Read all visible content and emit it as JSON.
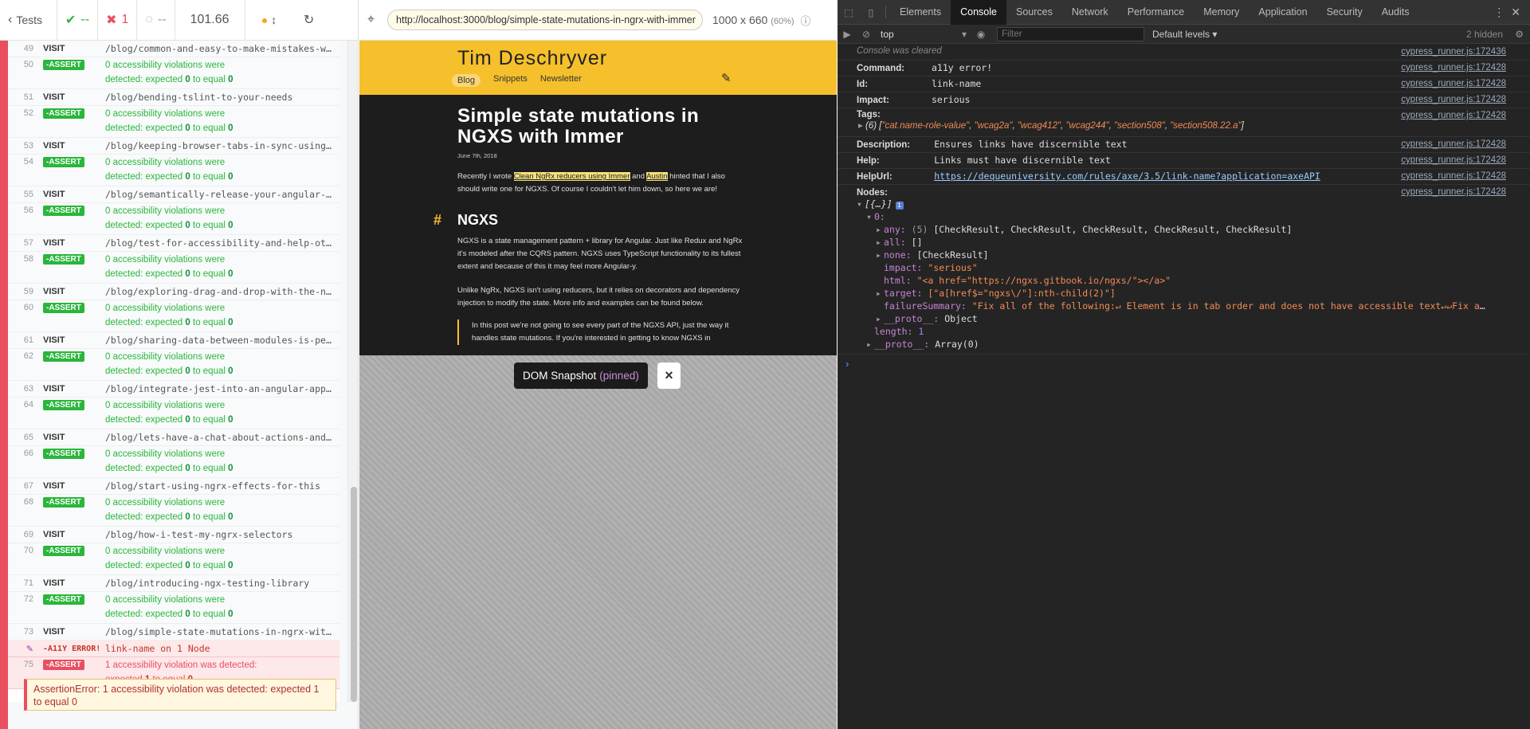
{
  "reporter": {
    "back_label": "Tests",
    "passed": "--",
    "failed": "1",
    "pending": "--",
    "duration": "101.66",
    "commands": [
      {
        "num": "49",
        "name": "VISIT",
        "msg": "/blog/common-and-easy-to-make-mistakes-when-you-re-new-to-ngrx"
      },
      {
        "num": "50",
        "name": "-ASSERT",
        "assert": true,
        "msg_a": "0 accessibility violations were",
        "msg_b": "detected: expected",
        "v1": "0",
        "to": "to equal",
        "v2": "0"
      },
      {
        "num": "51",
        "name": "VISIT",
        "msg": "/blog/bending-tslint-to-your-needs"
      },
      {
        "num": "52",
        "name": "-ASSERT",
        "assert": true,
        "msg_a": "0 accessibility violations were",
        "msg_b": "detected: expected",
        "v1": "0",
        "to": "to equal",
        "v2": "0"
      },
      {
        "num": "53",
        "name": "VISIT",
        "msg": "/blog/keeping-browser-tabs-in-sync-using-localstorage-ngrx-and-rxjs"
      },
      {
        "num": "54",
        "name": "-ASSERT",
        "assert": true,
        "msg_a": "0 accessibility violations were",
        "msg_b": "detected: expected",
        "v1": "0",
        "to": "to equal",
        "v2": "0"
      },
      {
        "num": "55",
        "name": "VISIT",
        "msg": "/blog/semantically-release-your-angular-library"
      },
      {
        "num": "56",
        "name": "-ASSERT",
        "assert": true,
        "msg_a": "0 accessibility violations were",
        "msg_b": "detected: expected",
        "v1": "0",
        "to": "to equal",
        "v2": "0"
      },
      {
        "num": "57",
        "name": "VISIT",
        "msg": "/blog/test-for-accessibility-and-help-others-to-do-the-same"
      },
      {
        "num": "58",
        "name": "-ASSERT",
        "assert": true,
        "msg_a": "0 accessibility violations were",
        "msg_b": "detected: expected",
        "v1": "0",
        "to": "to equal",
        "v2": "0"
      },
      {
        "num": "59",
        "name": "VISIT",
        "msg": "/blog/exploring-drag-and-drop-with-the-new-angular-material-cdk"
      },
      {
        "num": "60",
        "name": "-ASSERT",
        "assert": true,
        "msg_a": "0 accessibility violations were",
        "msg_b": "detected: expected",
        "v1": "0",
        "to": "to equal",
        "v2": "0"
      },
      {
        "num": "61",
        "name": "VISIT",
        "msg": "/blog/sharing-data-between-modules-is-peanuts"
      },
      {
        "num": "62",
        "name": "-ASSERT",
        "assert": true,
        "msg_a": "0 accessibility violations were",
        "msg_b": "detected: expected",
        "v1": "0",
        "to": "to equal",
        "v2": "0"
      },
      {
        "num": "63",
        "name": "VISIT",
        "msg": "/blog/integrate-jest-into-an-angular-application-and-library"
      },
      {
        "num": "64",
        "name": "-ASSERT",
        "assert": true,
        "msg_a": "0 accessibility violations were",
        "msg_b": "detected: expected",
        "v1": "0",
        "to": "to equal",
        "v2": "0"
      },
      {
        "num": "65",
        "name": "VISIT",
        "msg": "/blog/lets-have-a-chat-about-actions-and-selectors"
      },
      {
        "num": "66",
        "name": "-ASSERT",
        "assert": true,
        "msg_a": "0 accessibility violations were",
        "msg_b": "detected: expected",
        "v1": "0",
        "to": "to equal",
        "v2": "0"
      },
      {
        "num": "67",
        "name": "VISIT",
        "msg": "/blog/start-using-ngrx-effects-for-this"
      },
      {
        "num": "68",
        "name": "-ASSERT",
        "assert": true,
        "msg_a": "0 accessibility violations were",
        "msg_b": "detected: expected",
        "v1": "0",
        "to": "to equal",
        "v2": "0"
      },
      {
        "num": "69",
        "name": "VISIT",
        "msg": "/blog/how-i-test-my-ngrx-selectors"
      },
      {
        "num": "70",
        "name": "-ASSERT",
        "assert": true,
        "msg_a": "0 accessibility violations were",
        "msg_b": "detected: expected",
        "v1": "0",
        "to": "to equal",
        "v2": "0"
      },
      {
        "num": "71",
        "name": "VISIT",
        "msg": "/blog/introducing-ngx-testing-library"
      },
      {
        "num": "72",
        "name": "-ASSERT",
        "assert": true,
        "msg_a": "0 accessibility violations were",
        "msg_b": "detected: expected",
        "v1": "0",
        "to": "to equal",
        "v2": "0"
      },
      {
        "num": "73",
        "name": "VISIT",
        "msg": "/blog/simple-state-mutations-in-ngrx-with-immer"
      }
    ],
    "error_cmd": {
      "name": "-A11Y ERROR!",
      "msg": "link-name on 1 Node"
    },
    "fail_assert": {
      "num": "75",
      "name": "-ASSERT",
      "msg_a": "1 accessibility violation was detected:",
      "msg_b": "expected",
      "v1": "1",
      "to": "to equal",
      "v2": "0"
    },
    "error_box": "AssertionError: 1 accessibility violation was detected: expected 1 to equal 0"
  },
  "aut": {
    "url": "http://localhost:3000/blog/simple-state-mutations-in-ngrx-with-immer",
    "viewport": "1000 x 660",
    "zoom": "(60%)",
    "snapshot_label": "DOM Snapshot",
    "snapshot_state": "(pinned)",
    "close_glyph": "×"
  },
  "site": {
    "title": "Tim Deschryver",
    "nav": [
      "Blog",
      "Snippets",
      "Newsletter"
    ],
    "heading": "Simple state mutations in NGXS with Immer",
    "date": "June 7th, 2018",
    "intro_a": "Recently I wrote",
    "intro_link1": "Clean NgRx reducers using Immer",
    "intro_b": "and",
    "intro_link2": "Austin",
    "intro_c": "hinted that I also should write one for NGXS. Of course I couldn't let him down, so here we are!",
    "h2_hash": "#",
    "h2": "NGXS",
    "p1": "NGXS is a state management pattern + library for Angular. Just like Redux and NgRx it's modeled after the CQRS pattern. NGXS uses TypeScript functionality to its fullest extent and because of this it may feel more Angular-y.",
    "p2": "Unlike NgRx, NGXS isn't using reducers, but it relies on decorators and dependency injection to modify the state. More info and examples can be found below.",
    "quote": "In this post we're not going to see every part of the NGXS API, just the way it handles state mutations. If you're interested in getting to know NGXS in"
  },
  "devtools": {
    "tabs": [
      "Elements",
      "Console",
      "Sources",
      "Network",
      "Performance",
      "Memory",
      "Application",
      "Security",
      "Audits"
    ],
    "active_tab": "Console",
    "context": "top",
    "filter_placeholder": "Filter",
    "levels": "Default levels ▾",
    "hidden": "2 hidden",
    "cleared": "Console was cleared",
    "src1": "cypress_runner.js:172436",
    "src2": "cypress_runner.js:172428",
    "rows": [
      {
        "key": "Command:",
        "val": "a11y error!"
      },
      {
        "key": "Id:",
        "val": "link-name"
      },
      {
        "key": "Impact:",
        "val": "serious"
      }
    ],
    "tags_key": "Tags:",
    "tags_count": "(6)",
    "tags": [
      "\"cat.name-role-value\"",
      "\"wcag2a\"",
      "\"wcag412\"",
      "\"wcag244\"",
      "\"section508\"",
      "\"section508.22.a\""
    ],
    "desc_key": "Description:",
    "desc_val": "Ensures links have discernible text",
    "help_key": "Help:",
    "help_val": "Links must have discernible text",
    "helpurl_key": "HelpUrl:",
    "helpurl_val": "https://dequeuniversity.com/rules/axe/3.5/link-name?application=axeAPI",
    "nodes_key": "Nodes:",
    "node_tree": {
      "root": "[{…}]",
      "zero": "0:",
      "any_k": "any:",
      "any_c": "(5)",
      "any_v": "[CheckResult, CheckResult, CheckResult, CheckResult, CheckResult]",
      "all_k": "all:",
      "all_v": "[]",
      "none_k": "none:",
      "none_v": "[CheckResult]",
      "impact_k": "impact:",
      "impact_v": "\"serious\"",
      "html_k": "html:",
      "html_v": "\"<a href=\"https://ngxs.gitbook.io/ngxs/\"></a>\"",
      "target_k": "target:",
      "target_v": "[\"a[href$=\"ngxs\\/\"]:nth-child(2)\"]",
      "fail_k": "failureSummary:",
      "fail_v": "\"Fix all of the following:↵  Element is in tab order and does not have accessible text↵↵Fix any of the…",
      "proto_k": "__proto__:",
      "proto_v": "Object",
      "length_k": "length:",
      "length_v": "1",
      "aproto_k": "__proto__:",
      "aproto_v": "Array(0)"
    },
    "prompt": "›"
  }
}
